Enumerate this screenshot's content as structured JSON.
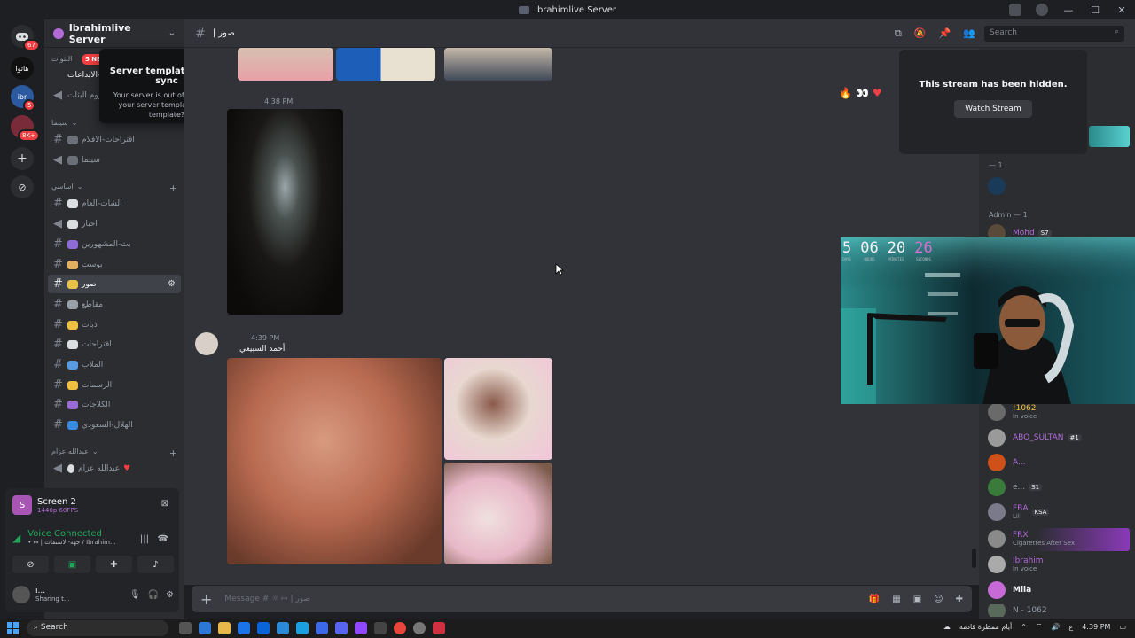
{
  "window": {
    "title": "Ibrahimlive Server"
  },
  "rail": {
    "badge_dm": "67",
    "server2_badge": "5",
    "server3_badge": "8K+"
  },
  "server": {
    "name": "Ibrahimlive Server",
    "new_pill": "5 NE"
  },
  "tooltip": {
    "title": "Server template out of sync",
    "body": "Your server is out of sync with your server template. Sync template?"
  },
  "channels": {
    "categories": [
      "سينما",
      "اساسي",
      "عبدالله عزام"
    ],
    "items": [
      {
        "name": "الثات-الابداعات"
      },
      {
        "name": "روم البثات"
      },
      {
        "name": "اقتراحات-الافلام"
      },
      {
        "name": "سينما"
      },
      {
        "name": "الشات-العام"
      },
      {
        "name": "اخبار"
      },
      {
        "name": "بث-المشهورين"
      },
      {
        "name": "بوست"
      },
      {
        "name": "صور"
      },
      {
        "name": "مقاطع"
      },
      {
        "name": "ذبات"
      },
      {
        "name": "اقتراحات"
      },
      {
        "name": "الملاب"
      },
      {
        "name": "الرسمات"
      },
      {
        "name": "الكلاجات"
      },
      {
        "name": "الهلال-السعودي"
      },
      {
        "name": "عبدالله عزام"
      }
    ]
  },
  "voice": {
    "screen_title": "Screen 2",
    "screen_quality": "1440p 60FPS",
    "status": "Voice Connected",
    "location": "• ↦ | جهة-الاسنفات / Ibrahim...",
    "user_name": "i...",
    "user_status": "Sharing t..."
  },
  "chat": {
    "channel_label": "| صور",
    "search_placeholder": "Search",
    "msg1_time": "4:38 PM",
    "msg2_time": "4:39 PM",
    "msg2_author": "أحمد السبيعي",
    "composer_placeholder": "Message # ☼ ↦ | صور"
  },
  "stream": {
    "hidden_text": "This stream has been hidden.",
    "watch_label": "Watch Stream"
  },
  "timer": {
    "days": "5",
    "hours": "06",
    "minutes": "20",
    "seconds": "26",
    "days_l": "DAYS",
    "hours_l": "HOURS",
    "minutes_l": "MINUTES",
    "seconds_l": "SECONDS"
  },
  "members": {
    "cat1": "— 1",
    "cat2": "Admin — 1",
    "list": [
      {
        "name": "Mohd",
        "tag": "S7",
        "status": ""
      },
      {
        "name": "!1062",
        "tag": "",
        "status": "In voice"
      },
      {
        "name": "ABO_SULTAN",
        "tag": "#1",
        "status": ""
      },
      {
        "name": "A...",
        "tag": "",
        "status": ""
      },
      {
        "name": "e...",
        "tag": "S1",
        "status": ""
      },
      {
        "name": "FBA",
        "tag": "KSA",
        "status": "Lil"
      },
      {
        "name": "FRX",
        "tag": "",
        "status": "Cigarettes After Sex"
      },
      {
        "name": "Ibrahim",
        "tag": "",
        "status": "In voice"
      },
      {
        "name": "Mila",
        "tag": "",
        "status": ""
      },
      {
        "name": "N - 1062",
        "tag": "",
        "status": ""
      }
    ]
  },
  "taskbar": {
    "search": "Search",
    "weather": "أيام ممطرة قادمة",
    "lang": "ع",
    "time": "4:39 PM"
  }
}
